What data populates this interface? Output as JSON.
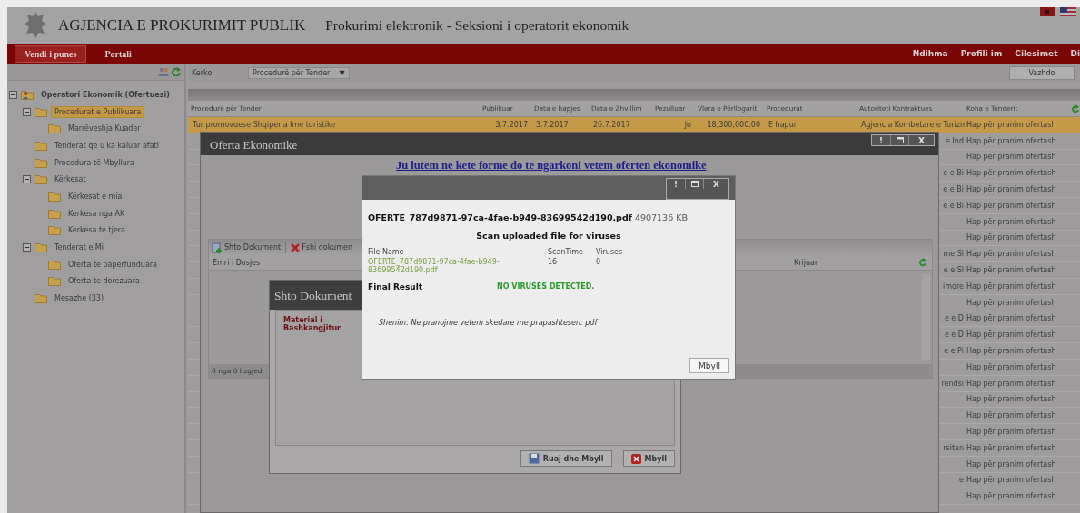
{
  "header": {
    "agency": "AGJENCIA E PROKURIMIT PUBLIK",
    "subtitle": "Prokurimi elektronik - Seksioni i operatorit ekonomik"
  },
  "nav": {
    "tabs": [
      {
        "label": "Vendi i punes",
        "selected": true
      },
      {
        "label": "Portali",
        "selected": false
      }
    ],
    "links": [
      "Ndihma",
      "Profili im",
      "Cilesimet",
      "Di"
    ]
  },
  "search": {
    "label": "Kerko:",
    "dropdown": "Procedurë për Tender",
    "dropdown_arrow": "▼",
    "button": "Vazhdo"
  },
  "tree": [
    {
      "label": "Operatori Ekonomik (Ofertuesi)",
      "kind": "root",
      "expanded": true,
      "selected": false,
      "children": [
        {
          "label": "Procedurat e Publikuara",
          "expanded": true,
          "selected": true,
          "children": [
            {
              "label": "Marrëveshja Kuader",
              "selected": false
            }
          ]
        },
        {
          "label": "Tenderat qe u ka kaluar afati",
          "selected": false
        },
        {
          "label": "Procedura të Mbyllura",
          "selected": false
        },
        {
          "label": "Kërkesat",
          "expanded": true,
          "selected": false,
          "children": [
            {
              "label": "Kërkesat e mia",
              "selected": false
            },
            {
              "label": "Kerkesa nga AK",
              "selected": false
            },
            {
              "label": "Kerkesa te tjera",
              "selected": false
            }
          ]
        },
        {
          "label": "Tenderat e Mi",
          "expanded": true,
          "selected": false,
          "children": [
            {
              "label": "Oferta te paperfunduara",
              "selected": false
            },
            {
              "label": "Oferta te dorezuara",
              "selected": false
            }
          ]
        },
        {
          "label": "Mesazhe (33)",
          "selected": false
        }
      ]
    }
  ],
  "table": {
    "columns": [
      "Procedurë për Tender",
      "Publikuar",
      "Data e hapjes",
      "Data e Zhvillim",
      "Pezulluar",
      "Vlera e Përllogarit",
      "Procedurat",
      "Autoriteti Kontraktues",
      "Koha e Tenderit"
    ],
    "rows": [
      {
        "selected": true,
        "cells": [
          "Tur promovuese Shqiperia Ime turistike",
          "3.7.2017",
          "3.7.2017",
          "26.7.2017",
          "Jo",
          "18,300,000.00",
          "E hapur",
          "Agjencia Kombetare e Turizm",
          "Hap për pranim ofertash"
        ]
      },
      {
        "selected": false,
        "authority": "e Ind",
        "status": "Hap për pranim ofertash"
      },
      {
        "selected": false,
        "status": "Hap për pranim ofertash"
      },
      {
        "selected": false,
        "authority": "e e Bi",
        "status": "Hap për pranim ofertash"
      },
      {
        "selected": false,
        "authority": "e e Bi",
        "status": "Hap për pranim ofertash"
      },
      {
        "selected": false,
        "authority": "e e Bi",
        "status": "Hap për pranim ofertash"
      },
      {
        "selected": false,
        "status": "Hap për pranim ofertash"
      },
      {
        "selected": false,
        "status": "Hap për pranim ofertash"
      },
      {
        "selected": false,
        "authority": "me Sl",
        "status": "Hap për pranim ofertash"
      },
      {
        "selected": false,
        "authority": "e e Sl",
        "status": "Hap për pranim ofertash"
      },
      {
        "selected": false,
        "authority": "imore",
        "status": "Hap për pranim ofertash"
      },
      {
        "selected": false,
        "status": "Hap për pranim ofertash"
      },
      {
        "selected": false,
        "authority": "e e D",
        "status": "Hap për pranim ofertash"
      },
      {
        "selected": false,
        "authority": "e e D",
        "status": "Hap për pranim ofertash"
      },
      {
        "selected": false,
        "authority": "e e Pi",
        "status": "Hap për pranim ofertash"
      },
      {
        "selected": false,
        "status": "Hap për pranim ofertash"
      },
      {
        "selected": false,
        "authority": "rendsi",
        "status": "Hap për pranim ofertash"
      },
      {
        "selected": false,
        "status": "Hap për pranim ofertash"
      },
      {
        "selected": false,
        "status": "Hap për pranim ofertash"
      },
      {
        "selected": false,
        "status": "Hap për pranim ofertash"
      },
      {
        "selected": false,
        "authority": "rsitan",
        "status": "Hap për pranim ofertash"
      },
      {
        "selected": false,
        "status": "Hap për pranim ofertash"
      },
      {
        "selected": false,
        "authority": "e",
        "status": "Hap për pranim ofertash"
      },
      {
        "selected": false,
        "status": "Hap për pranim ofertash"
      }
    ]
  },
  "offer_window": {
    "title": "Oferta Ekonomike",
    "controls": [
      {
        "kind": "help",
        "label": "!"
      },
      {
        "kind": "maximize"
      },
      {
        "kind": "close",
        "label": "X"
      }
    ],
    "instruction": "Ju lutem ne kete forme do te ngarkoni vetem oferten ekonomike",
    "toolbar": [
      {
        "kind": "add",
        "label": "Shto Dokument"
      },
      {
        "kind": "delete",
        "label": "Fshi dokumen"
      }
    ],
    "columns": [
      "Emri i Dosjes",
      "Krijuar"
    ],
    "footer": "0 nga 0 I zgjed"
  },
  "add_document_dialog": {
    "title": "Shto Dokument",
    "field_label": "Material i Bashkangjitur",
    "buttons": [
      {
        "kind": "save",
        "label": "Ruaj dhe Mbyll"
      },
      {
        "kind": "close",
        "label": "Mbyll"
      }
    ]
  },
  "scan_dialog": {
    "controls": [
      {
        "kind": "help",
        "label": "!"
      },
      {
        "kind": "maximize"
      },
      {
        "kind": "close",
        "label": "X"
      }
    ],
    "file_heading": "**OFERTE_787d9871-97ca-4fae-b949-83699542d190.pdf** 4907136 KB",
    "heading": "Scan uploaded file for viruses",
    "columns": [
      "File Name",
      "ScanTime",
      "Viruses"
    ],
    "values": [
      "OFERTE_787d9871-97ca-4fae-b949-83699542d190.pdf",
      "16",
      "0"
    ],
    "final_label": "Final Result",
    "final_value": "NO VIRUSES DETECTED.",
    "note": "Shenim: Ne pranojme vetem skedare me prapashtesen: pdf",
    "button": "Mbyll"
  }
}
